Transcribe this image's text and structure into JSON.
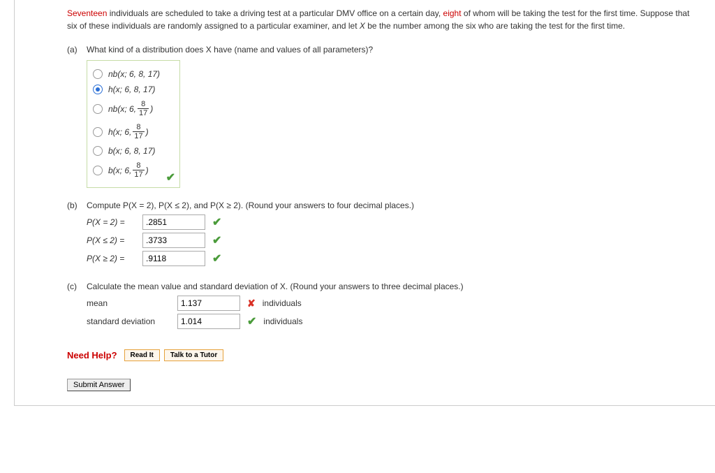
{
  "problem": {
    "n_total_word": "Seventeen",
    "intro1": " individuals are scheduled to take a driving test at a particular DMV office on a certain day, ",
    "n_first_word": "eight",
    "intro2": " of whom will be taking the test for the first time. Suppose that six of these individuals are randomly assigned to a particular examiner, and let ",
    "varX": "X",
    "intro3": " be the number among the six who are taking the test for the first time."
  },
  "a": {
    "label": "(a)",
    "question": "What kind of a distribution does X have (name and values of all parameters)?",
    "options": {
      "o1": "nb(x; 6, 8, 17)",
      "o2": "h(x; 6, 8, 17)",
      "o3_pre": "nb(x; 6, ",
      "o4_pre": "h(x; 6, ",
      "o5": "b(x; 6, 8, 17)",
      "o6_pre": "b(x; 6, ",
      "frac_num": "8",
      "frac_den": "17",
      "close": ")"
    }
  },
  "b": {
    "label": "(b)",
    "question": "Compute P(X = 2), P(X ≤ 2), and P(X ≥ 2). (Round your answers to four decimal places.)",
    "rows": {
      "r1_label": "P(X = 2)  = ",
      "r1_val": ".2851",
      "r2_label": "P(X ≤ 2)  = ",
      "r2_val": ".3733",
      "r3_label": "P(X ≥ 2)  = ",
      "r3_val": ".9118"
    }
  },
  "c": {
    "label": "(c)",
    "question": "Calculate the mean value and standard deviation of X. (Round your answers to three decimal places.)",
    "mean_label": "mean",
    "mean_val": "1.137",
    "sd_label": "standard deviation",
    "sd_val": "1.014",
    "unit": "individuals"
  },
  "help": {
    "label": "Need Help?",
    "read": "Read It",
    "tutor": "Talk to a Tutor"
  },
  "submit": "Submit Answer"
}
